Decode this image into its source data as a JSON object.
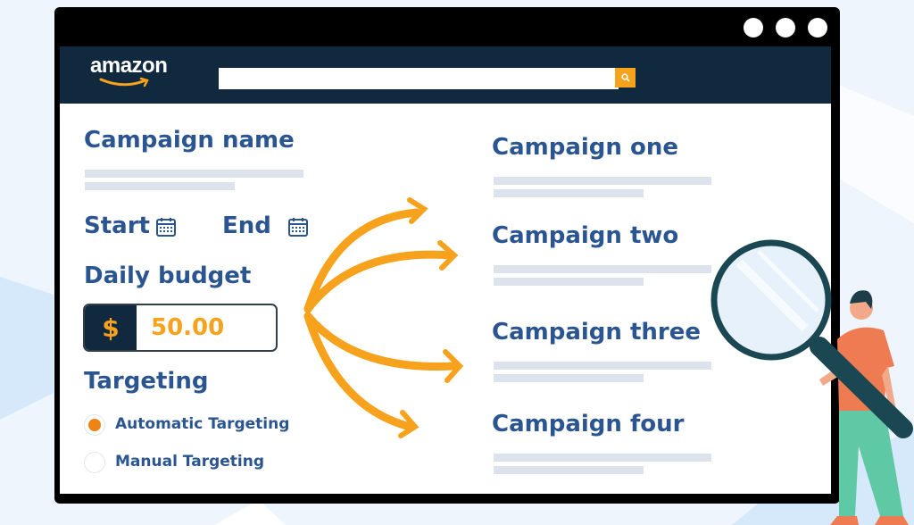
{
  "window": {
    "controls": [
      "dot",
      "dot",
      "dot"
    ]
  },
  "header": {
    "logo_text": "amazon",
    "search": {
      "value": "",
      "placeholder": ""
    },
    "search_icon": "search-icon"
  },
  "form": {
    "campaign_name_label": "Campaign name",
    "start_label": "Start",
    "end_label": "End",
    "calendar_icon": "calendar-icon",
    "daily_budget_label": "Daily budget",
    "budget": {
      "currency_symbol": "$",
      "value": "50.00"
    },
    "targeting_label": "Targeting",
    "targeting_options": [
      {
        "label": "Automatic Targeting",
        "selected": true
      },
      {
        "label": "Manual Targeting",
        "selected": false
      }
    ]
  },
  "campaigns": [
    {
      "title": "Campaign one"
    },
    {
      "title": "Campaign two"
    },
    {
      "title": "Campaign three"
    },
    {
      "title": "Campaign four"
    }
  ],
  "colors": {
    "accent_orange": "#f7a21c",
    "navy": "#11293f",
    "heading_blue": "#2a5591",
    "placeholder_gray": "#dde3ec"
  }
}
